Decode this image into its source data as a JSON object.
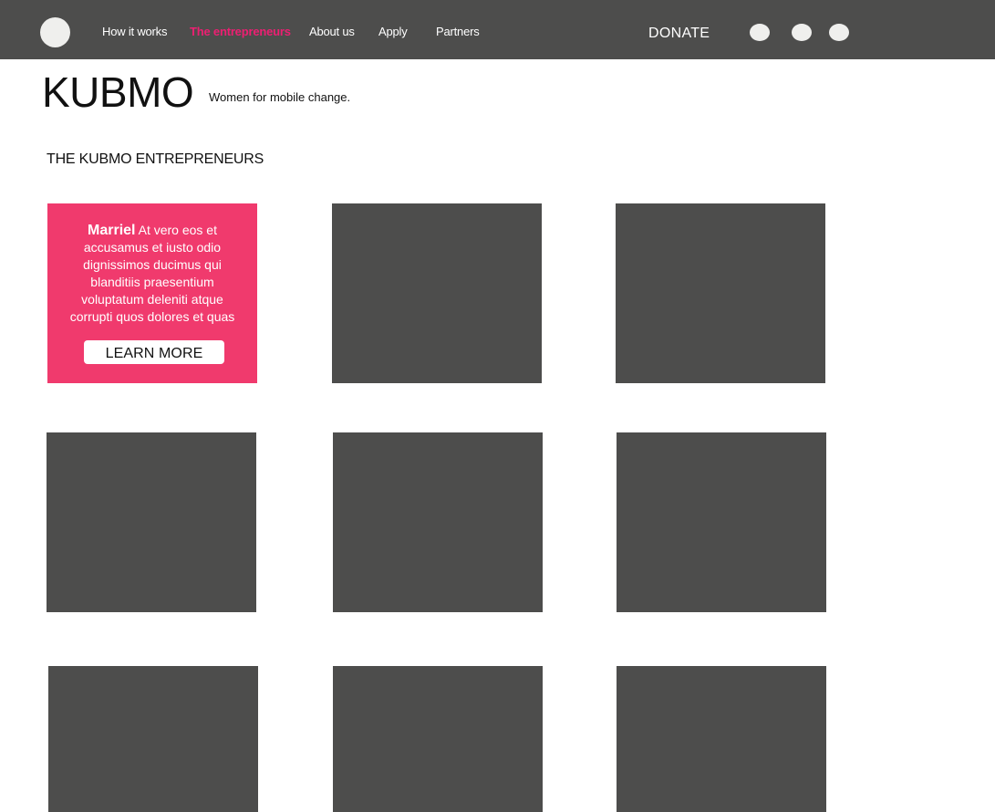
{
  "nav": {
    "links": [
      {
        "label": "How it works"
      },
      {
        "label": "The entrepreneurs",
        "active": true
      },
      {
        "label": "About us"
      },
      {
        "label": "Apply"
      },
      {
        "label": "Partners"
      }
    ],
    "donate_label": "DONATE",
    "social_icons": [
      "social-icon",
      "social-icon",
      "social-icon"
    ]
  },
  "brand": {
    "name": "KUBMO",
    "tagline": "Women for mobile change."
  },
  "section": {
    "heading": "THE KUBMO ENTREPRENEURS"
  },
  "featured": {
    "name": "Marriel",
    "text": " At vero eos et accusamus et iusto odio dignissimos ducimus qui blanditiis praesentium voluptatum deleniti atque corrupti quos dolores et quas",
    "button_label": "LEARN MORE"
  },
  "colors": {
    "nav_bg": "#4d4d4c",
    "accent": "#ed1f72",
    "featured_bg": "#f03a6d",
    "tile_bg": "#4d4d4c"
  }
}
